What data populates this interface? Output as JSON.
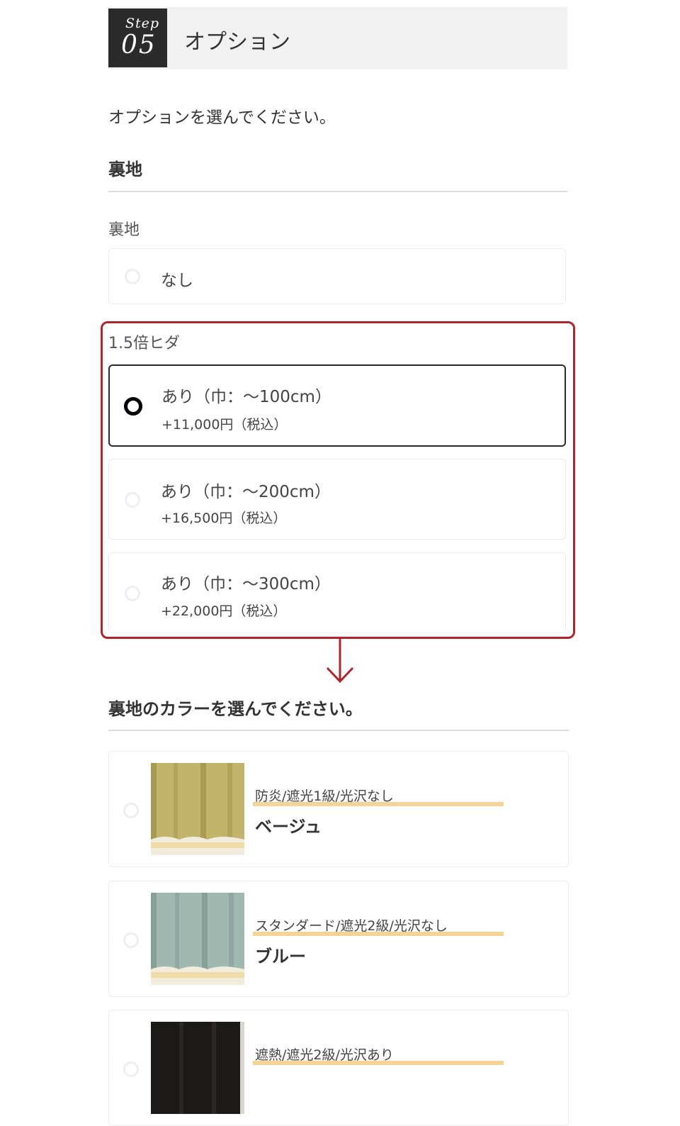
{
  "step": {
    "word": "Step",
    "number": "05",
    "title": "オプション"
  },
  "intro": "オプションを選んでください。",
  "lining": {
    "heading": "裏地",
    "label": "裏地",
    "options": [
      {
        "label": "なし",
        "selected": false
      }
    ]
  },
  "pleat": {
    "label": "1.5倍ヒダ",
    "options": [
      {
        "label": "あり（巾：〜100cm）",
        "price": "+11,000円（税込）",
        "selected": true
      },
      {
        "label": "あり（巾：〜200cm）",
        "price": "+16,500円（税込）",
        "selected": false
      },
      {
        "label": "あり（巾：〜300cm）",
        "price": "+22,000円（税込）",
        "selected": false
      }
    ]
  },
  "colors": {
    "heading": "裏地のカラーを選んでください。",
    "items": [
      {
        "spec": "防炎/遮光1級/光沢なし",
        "name": "ベージュ",
        "swatch": "#c2b46a"
      },
      {
        "spec": "スタンダード/遮光2級/光沢なし",
        "name": "ブルー",
        "swatch": "#9fb8b0"
      },
      {
        "spec": "遮熱/遮光2級/光沢あり",
        "name": "",
        "swatch": "#1c1a18"
      }
    ]
  },
  "accent": {
    "highlight": "#b0242b",
    "underline": "#f3d496"
  },
  "icons": {
    "arrow": "arrow-down-icon"
  }
}
